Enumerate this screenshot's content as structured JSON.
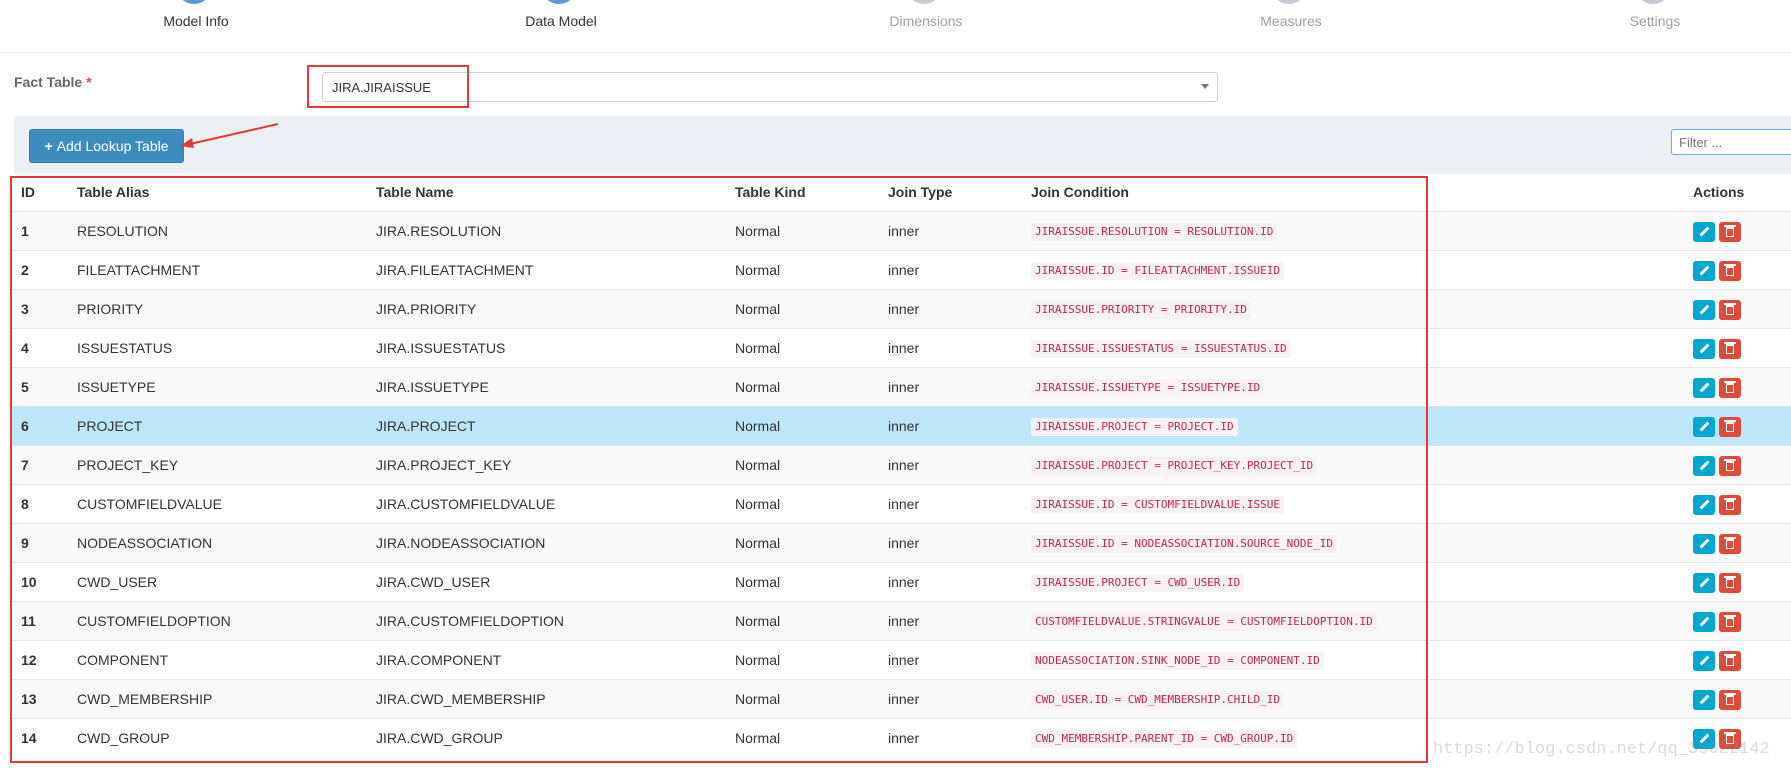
{
  "wizard": {
    "steps": [
      {
        "label": "Model Info",
        "state": "done"
      },
      {
        "label": "Data Model",
        "state": "done"
      },
      {
        "label": "Dimensions",
        "state": "pending"
      },
      {
        "label": "Measures",
        "state": "pending"
      },
      {
        "label": "Settings",
        "state": "pending"
      }
    ]
  },
  "fact": {
    "label": "Fact Table",
    "required_mark": "*",
    "selected": "JIRA.JIRAISSUE"
  },
  "toolbar": {
    "add_label": "Add Lookup Table",
    "add_icon": "plus-icon",
    "filter_placeholder": "Filter ..."
  },
  "table": {
    "headers": {
      "id": "ID",
      "alias": "Table Alias",
      "name": "Table Name",
      "kind": "Table Kind",
      "join": "Join Type",
      "cond": "Join Condition",
      "actions": "Actions"
    },
    "rows": [
      {
        "id": "1",
        "alias": "RESOLUTION",
        "name": "JIRA.RESOLUTION",
        "kind": "Normal",
        "join": "inner",
        "cond": "JIRAISSUE.RESOLUTION = RESOLUTION.ID"
      },
      {
        "id": "2",
        "alias": "FILEATTACHMENT",
        "name": "JIRA.FILEATTACHMENT",
        "kind": "Normal",
        "join": "inner",
        "cond": "JIRAISSUE.ID = FILEATTACHMENT.ISSUEID"
      },
      {
        "id": "3",
        "alias": "PRIORITY",
        "name": "JIRA.PRIORITY",
        "kind": "Normal",
        "join": "inner",
        "cond": "JIRAISSUE.PRIORITY = PRIORITY.ID"
      },
      {
        "id": "4",
        "alias": "ISSUESTATUS",
        "name": "JIRA.ISSUESTATUS",
        "kind": "Normal",
        "join": "inner",
        "cond": "JIRAISSUE.ISSUESTATUS = ISSUESTATUS.ID"
      },
      {
        "id": "5",
        "alias": "ISSUETYPE",
        "name": "JIRA.ISSUETYPE",
        "kind": "Normal",
        "join": "inner",
        "cond": "JIRAISSUE.ISSUETYPE = ISSUETYPE.ID"
      },
      {
        "id": "6",
        "alias": "PROJECT",
        "name": "JIRA.PROJECT",
        "kind": "Normal",
        "join": "inner",
        "cond": "JIRAISSUE.PROJECT = PROJECT.ID",
        "selected": true
      },
      {
        "id": "7",
        "alias": "PROJECT_KEY",
        "name": "JIRA.PROJECT_KEY",
        "kind": "Normal",
        "join": "inner",
        "cond": "JIRAISSUE.PROJECT = PROJECT_KEY.PROJECT_ID"
      },
      {
        "id": "8",
        "alias": "CUSTOMFIELDVALUE",
        "name": "JIRA.CUSTOMFIELDVALUE",
        "kind": "Normal",
        "join": "inner",
        "cond": "JIRAISSUE.ID = CUSTOMFIELDVALUE.ISSUE"
      },
      {
        "id": "9",
        "alias": "NODEASSOCIATION",
        "name": "JIRA.NODEASSOCIATION",
        "kind": "Normal",
        "join": "inner",
        "cond": "JIRAISSUE.ID = NODEASSOCIATION.SOURCE_NODE_ID"
      },
      {
        "id": "10",
        "alias": "CWD_USER",
        "name": "JIRA.CWD_USER",
        "kind": "Normal",
        "join": "inner",
        "cond": "JIRAISSUE.PROJECT = CWD_USER.ID"
      },
      {
        "id": "11",
        "alias": "CUSTOMFIELDOPTION",
        "name": "JIRA.CUSTOMFIELDOPTION",
        "kind": "Normal",
        "join": "inner",
        "cond": "CUSTOMFIELDVALUE.STRINGVALUE = CUSTOMFIELDOPTION.ID"
      },
      {
        "id": "12",
        "alias": "COMPONENT",
        "name": "JIRA.COMPONENT",
        "kind": "Normal",
        "join": "inner",
        "cond": "NODEASSOCIATION.SINK_NODE_ID = COMPONENT.ID"
      },
      {
        "id": "13",
        "alias": "CWD_MEMBERSHIP",
        "name": "JIRA.CWD_MEMBERSHIP",
        "kind": "Normal",
        "join": "inner",
        "cond": "CWD_USER.ID = CWD_MEMBERSHIP.CHILD_ID"
      },
      {
        "id": "14",
        "alias": "CWD_GROUP",
        "name": "JIRA.CWD_GROUP",
        "kind": "Normal",
        "join": "inner",
        "cond": "CWD_MEMBERSHIP.PARENT_ID = CWD_GROUP.ID"
      }
    ]
  },
  "actions": {
    "edit_icon": "pencil-icon",
    "delete_icon": "trash-icon"
  },
  "watermark": "https://blog.csdn.net/qq_35622142",
  "colors": {
    "primary": "#3c8dbc",
    "info": "#00a7d0",
    "danger": "#dd4b39",
    "highlight": "#e53935",
    "selected_row": "#bde6f9",
    "code_text": "#c7254e"
  }
}
